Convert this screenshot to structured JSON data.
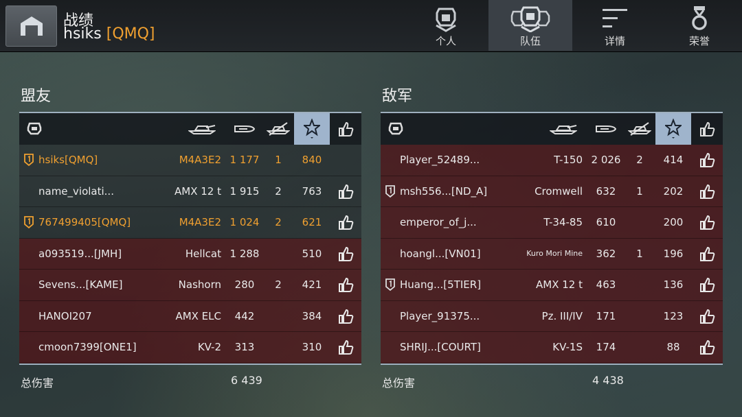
{
  "header": {
    "title": "战绩",
    "player": "hsiks",
    "clan": "[QMQ]"
  },
  "tabs": [
    {
      "label": "个人",
      "icon": "personal-tank-icon"
    },
    {
      "label": "队伍",
      "icon": "team-icon",
      "active": true
    },
    {
      "label": "详情",
      "icon": "details-lines-icon"
    },
    {
      "label": "荣誉",
      "icon": "medal-icon"
    }
  ],
  "allies": {
    "title": "盟友",
    "total_label": "总伤害",
    "total": "6 439",
    "rows": [
      {
        "name": "hsiks[QMQ]",
        "vehicle": "M4A3E2",
        "damage": "1 177",
        "kills": "1",
        "score": "840",
        "highlight": true,
        "platoon": true,
        "like": false
      },
      {
        "name": "name_violati...",
        "vehicle": "AMX 12 t",
        "damage": "1 915",
        "kills": "2",
        "score": "763",
        "like": true
      },
      {
        "name": "767499405[QMQ]",
        "vehicle": "M4A3E2",
        "damage": "1 024",
        "kills": "2",
        "score": "621",
        "highlight": true,
        "platoon": true,
        "like": true
      },
      {
        "name": "a093519...[JMH]",
        "vehicle": "Hellcat",
        "damage": "1 288",
        "kills": "",
        "score": "510",
        "dead": true,
        "like": true
      },
      {
        "name": "Sevens...[KAME]",
        "vehicle": "Nashorn",
        "damage": "280",
        "kills": "2",
        "score": "421",
        "dead": true,
        "like": true
      },
      {
        "name": "HANOI207",
        "vehicle": "AMX ELC",
        "damage": "442",
        "kills": "",
        "score": "384",
        "dead": true,
        "like": true
      },
      {
        "name": "cmoon7399[ONE1]",
        "vehicle": "KV-2",
        "damage": "313",
        "kills": "",
        "score": "310",
        "dead": true,
        "like": true
      }
    ]
  },
  "enemies": {
    "title": "敌军",
    "total_label": "总伤害",
    "total": "4 438",
    "rows": [
      {
        "name": "Player_52489...",
        "vehicle": "T-150",
        "damage": "2 026",
        "kills": "2",
        "score": "414"
      },
      {
        "name": "msh556...[ND_A]",
        "vehicle": "Cromwell",
        "damage": "632",
        "kills": "1",
        "score": "202",
        "platoon": true
      },
      {
        "name": "emperor_of_j...",
        "vehicle": "T-34-85",
        "damage": "610",
        "kills": "",
        "score": "200"
      },
      {
        "name": "hoangl...[VN01]",
        "vehicle": "Kuro Mori Mine",
        "damage": "362",
        "kills": "1",
        "score": "196",
        "small": true
      },
      {
        "name": "Huang...[5TIER]",
        "vehicle": "AMX 12 t",
        "damage": "463",
        "kills": "",
        "score": "136",
        "platoon": true
      },
      {
        "name": "Player_91375...",
        "vehicle": "Pz. III/IV",
        "damage": "171",
        "kills": "",
        "score": "123"
      },
      {
        "name": "SHRIJ...[COURT]",
        "vehicle": "KV-1S",
        "damage": "174",
        "kills": "",
        "score": "88"
      }
    ]
  },
  "colors": {
    "accent": "#f0a030",
    "enemy_row": "#50161a",
    "sort_header": "#9fb4cc"
  }
}
